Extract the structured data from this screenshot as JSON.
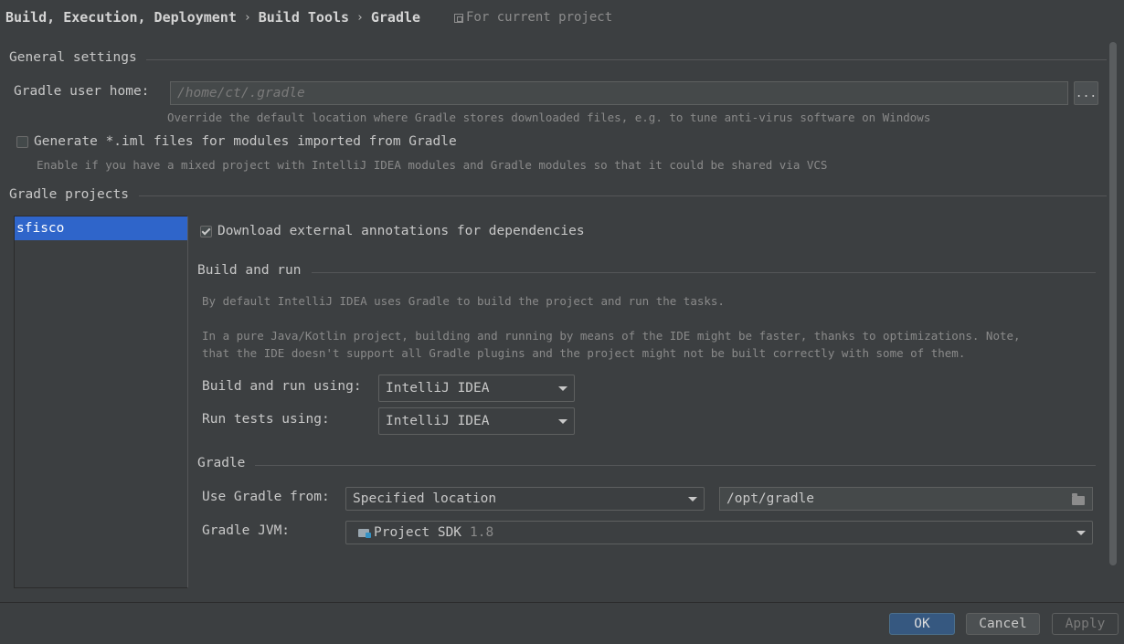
{
  "breadcrumb": {
    "items": [
      "Build, Execution, Deployment",
      "Build Tools",
      "Gradle"
    ],
    "separator": "›",
    "scope_label": "For current project"
  },
  "general": {
    "section_title": "General settings",
    "gradle_user_home_label": "Gradle user home:",
    "gradle_user_home_placeholder": "/home/ct/.gradle",
    "browse_label": "...",
    "gradle_user_home_hint": "Override the default location where Gradle stores downloaded files, e.g. to tune anti-virus software on Windows",
    "generate_iml_label": "Generate *.iml files for modules imported from Gradle",
    "generate_iml_checked": false,
    "generate_iml_hint": "Enable if you have a mixed project with IntelliJ IDEA modules and Gradle modules so that it could be shared via VCS"
  },
  "projects": {
    "section_title": "Gradle projects",
    "items": [
      "sfisco"
    ],
    "selected": "sfisco"
  },
  "project_settings": {
    "download_annotations_label": "Download external annotations for dependencies",
    "download_annotations_checked": true,
    "build_and_run": {
      "section_title": "Build and run",
      "desc1": "By default IntelliJ IDEA uses Gradle to build the project and run the tasks.",
      "desc2_line1": "In a pure Java/Kotlin project, building and running by means of the IDE might be faster, thanks to optimizations. Note,",
      "desc2_line2": "that the IDE doesn't support all Gradle plugins and the project might not be built correctly with some of them.",
      "build_run_label": "Build and run using:",
      "build_run_value": "IntelliJ IDEA",
      "run_tests_label": "Run tests using:",
      "run_tests_value": "IntelliJ IDEA"
    },
    "gradle": {
      "section_title": "Gradle",
      "use_gradle_from_label": "Use Gradle from:",
      "use_gradle_from_value": "Specified location",
      "gradle_location_value": "/opt/gradle",
      "gradle_jvm_label": "Gradle JVM:",
      "gradle_jvm_value": "Project SDK",
      "gradle_jvm_version": "1.8"
    }
  },
  "footer": {
    "ok_label": "OK",
    "cancel_label": "Cancel",
    "apply_label": "Apply"
  },
  "colors": {
    "background": "#3c3f41",
    "selection": "#2f65ca",
    "ok_button": "#365880"
  }
}
